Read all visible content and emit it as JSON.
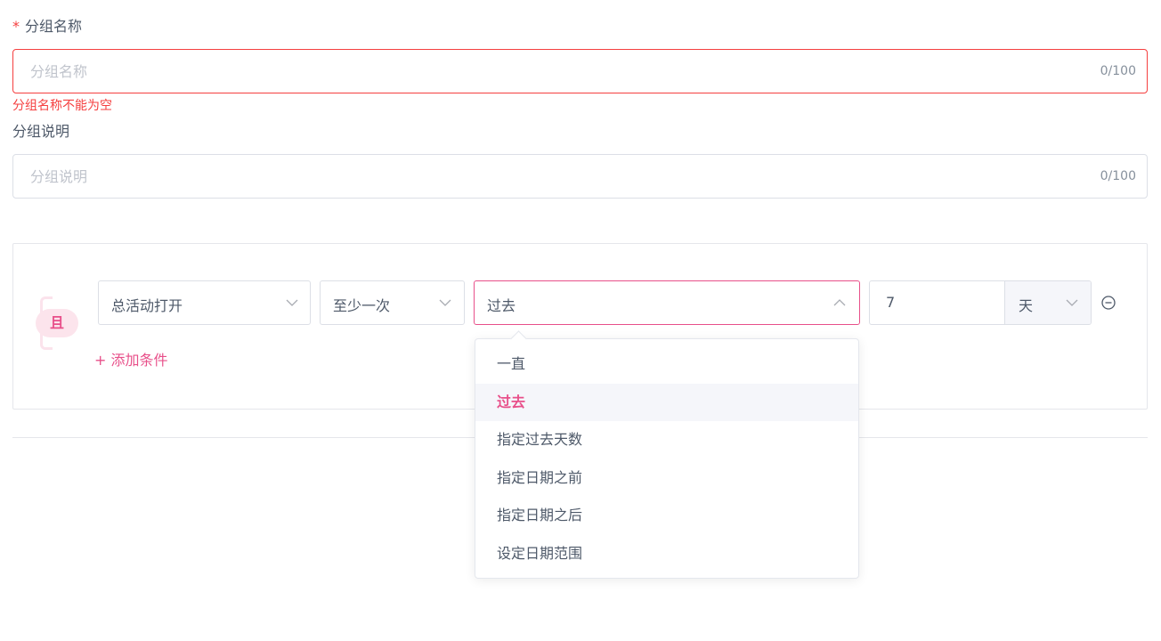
{
  "form": {
    "name_field": {
      "required_mark": "*",
      "label": "分组名称",
      "placeholder": "分组名称",
      "value": "",
      "counter": "0/100",
      "error": "分组名称不能为空"
    },
    "desc_field": {
      "label": "分组说明",
      "placeholder": "分组说明",
      "value": "",
      "counter": "0/100"
    }
  },
  "rule": {
    "logic": "且",
    "condition": {
      "event": "总活动打开",
      "frequency": "至少一次",
      "time_range": "过去",
      "number": "7",
      "unit": "天"
    },
    "add_condition": "+ 添加条件"
  },
  "dropdown": {
    "selected_index": 1,
    "options": [
      "一直",
      "过去",
      "指定过去天数",
      "指定日期之前",
      "指定日期之后",
      "设定日期范围"
    ]
  },
  "colors": {
    "accent": "#e8508a",
    "error": "#f53f3f",
    "border": "#dcdfe6",
    "text": "#4e5969",
    "placeholder": "#c0c4cc"
  },
  "icons": {
    "chevron_down": "chevron-down-icon",
    "chevron_up": "chevron-up-icon",
    "remove": "minus-circle-icon"
  }
}
